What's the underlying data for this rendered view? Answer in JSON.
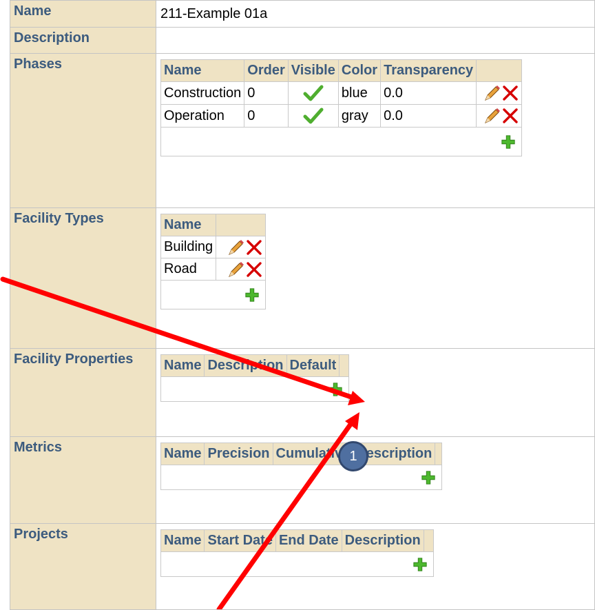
{
  "name_label": "Name",
  "name_value": "211-Example 01a",
  "description_label": "Description",
  "description_value": "",
  "phases": {
    "label": "Phases",
    "columns": [
      "Name",
      "Order",
      "Visible",
      "Color",
      "Transparency"
    ],
    "rows": [
      {
        "name": "Construction",
        "order": "0",
        "visible": true,
        "color": "blue",
        "transparency": "0.0"
      },
      {
        "name": "Operation",
        "order": "0",
        "visible": true,
        "color": "gray",
        "transparency": "0.0"
      }
    ]
  },
  "facility_types": {
    "label": "Facility Types",
    "columns": [
      "Name"
    ],
    "rows": [
      {
        "name": "Building"
      },
      {
        "name": "Road"
      }
    ]
  },
  "facility_properties": {
    "label": "Facility Properties",
    "columns": [
      "Name",
      "Description",
      "Default"
    ]
  },
  "metrics": {
    "label": "Metrics",
    "columns": [
      "Name",
      "Precision",
      "Cumulative",
      "Description"
    ]
  },
  "projects": {
    "label": "Projects",
    "columns": [
      "Name",
      "Start Date",
      "End Date",
      "Description"
    ]
  },
  "annotation": {
    "marker_number": "1",
    "arrow_color": "#ff0000",
    "marker_color": "#4f6fa0"
  },
  "icons": {
    "edit": "pencil-icon",
    "delete": "delete-x-icon",
    "add": "add-plus-icon",
    "visible": "checkmark-icon"
  }
}
